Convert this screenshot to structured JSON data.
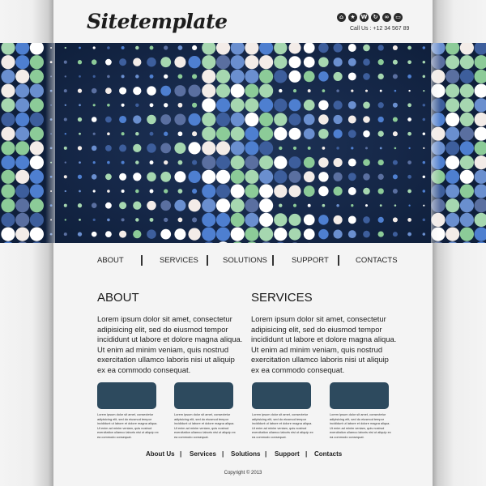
{
  "site": {
    "logo": "Sitetemplate",
    "call_us": "Call Us : +12 34 567 89",
    "social_icons": [
      {
        "name": "home-icon",
        "glyph": "⌂"
      },
      {
        "name": "star-icon",
        "glyph": "★"
      },
      {
        "name": "wordpress-icon",
        "glyph": "W"
      },
      {
        "name": "refresh-icon",
        "glyph": "↻"
      },
      {
        "name": "link-icon",
        "glyph": "∞"
      },
      {
        "name": "message-icon",
        "glyph": "▭"
      }
    ]
  },
  "banner": {
    "background": "#0f1f3b",
    "dot_colors": [
      "#ffffff",
      "#f3ece8",
      "#8ccb98",
      "#a6d7b0",
      "#4e7fd0",
      "#6a8fcf",
      "#5a6fa0",
      "#3d5e9c"
    ]
  },
  "nav": {
    "items": [
      "ABOUT",
      "SERVICES",
      "SOLUTIONS",
      "SUPPORT",
      "CONTACTS"
    ]
  },
  "sections": [
    {
      "title": "ABOUT",
      "body": "Lorem ipsum dolor sit amet, consectetur adipisicing elit, sed do eiusmod tempor incididunt ut labore et dolore magna aliqua. Ut enim ad minim veniam, quis nostrud exercitation ullamco laboris nisi ut aliquip ex ea commodo consequat."
    },
    {
      "title": "SERVICES",
      "body": "Lorem ipsum dolor sit amet, consectetur adipisicing elit, sed do eiusmod tempor incididunt ut labore et dolore magna aliqua. Ut enim ad minim veniam, quis nostrud exercitation ullamco laboris nisi ut aliquip ex ea commodo consequat."
    }
  ],
  "cards": [
    {
      "text": "Lorem ipsum dolor sit amet, consectetur adipisicing elit, sed do eiusmod tempor incididunt ut labore et dolore magna aliqua. Ut enim ad minim veniam, quis nostrud exercitation ullamco laboris nisi ut aliquip ex ea commodo consequat."
    },
    {
      "text": "Lorem ipsum dolor sit amet, consectetur adipisicing elit, sed do eiusmod tempor incididunt ut labore et dolore magna aliqua. Ut enim ad minim veniam, quis nostrud exercitation ullamco laboris nisi ut aliquip ex ea commodo consequat."
    },
    {
      "text": "Lorem ipsum dolor sit amet, consectetur adipisicing elit, sed do eiusmod tempor incididunt ut labore et dolore magna aliqua. Ut enim ad minim veniam, quis nostrud exercitation ullamco laboris nisi ut aliquip ex ea commodo consequat."
    },
    {
      "text": "Lorem ipsum dolor sit amet, consectetur adipisicing elit, sed do eiusmod tempor incididunt ut labore et dolore magna aliqua. Ut enim ad minim veniam, quis nostrud exercitation ullamco laboris nisi ut aliquip ex ea commodo consequat."
    }
  ],
  "card_color": "#2d4a5e",
  "footer": {
    "links": [
      "About Us",
      "Services",
      "Solutions",
      "Support",
      "Contacts"
    ],
    "separator": "|",
    "copyright": "Copyright © 2013"
  }
}
